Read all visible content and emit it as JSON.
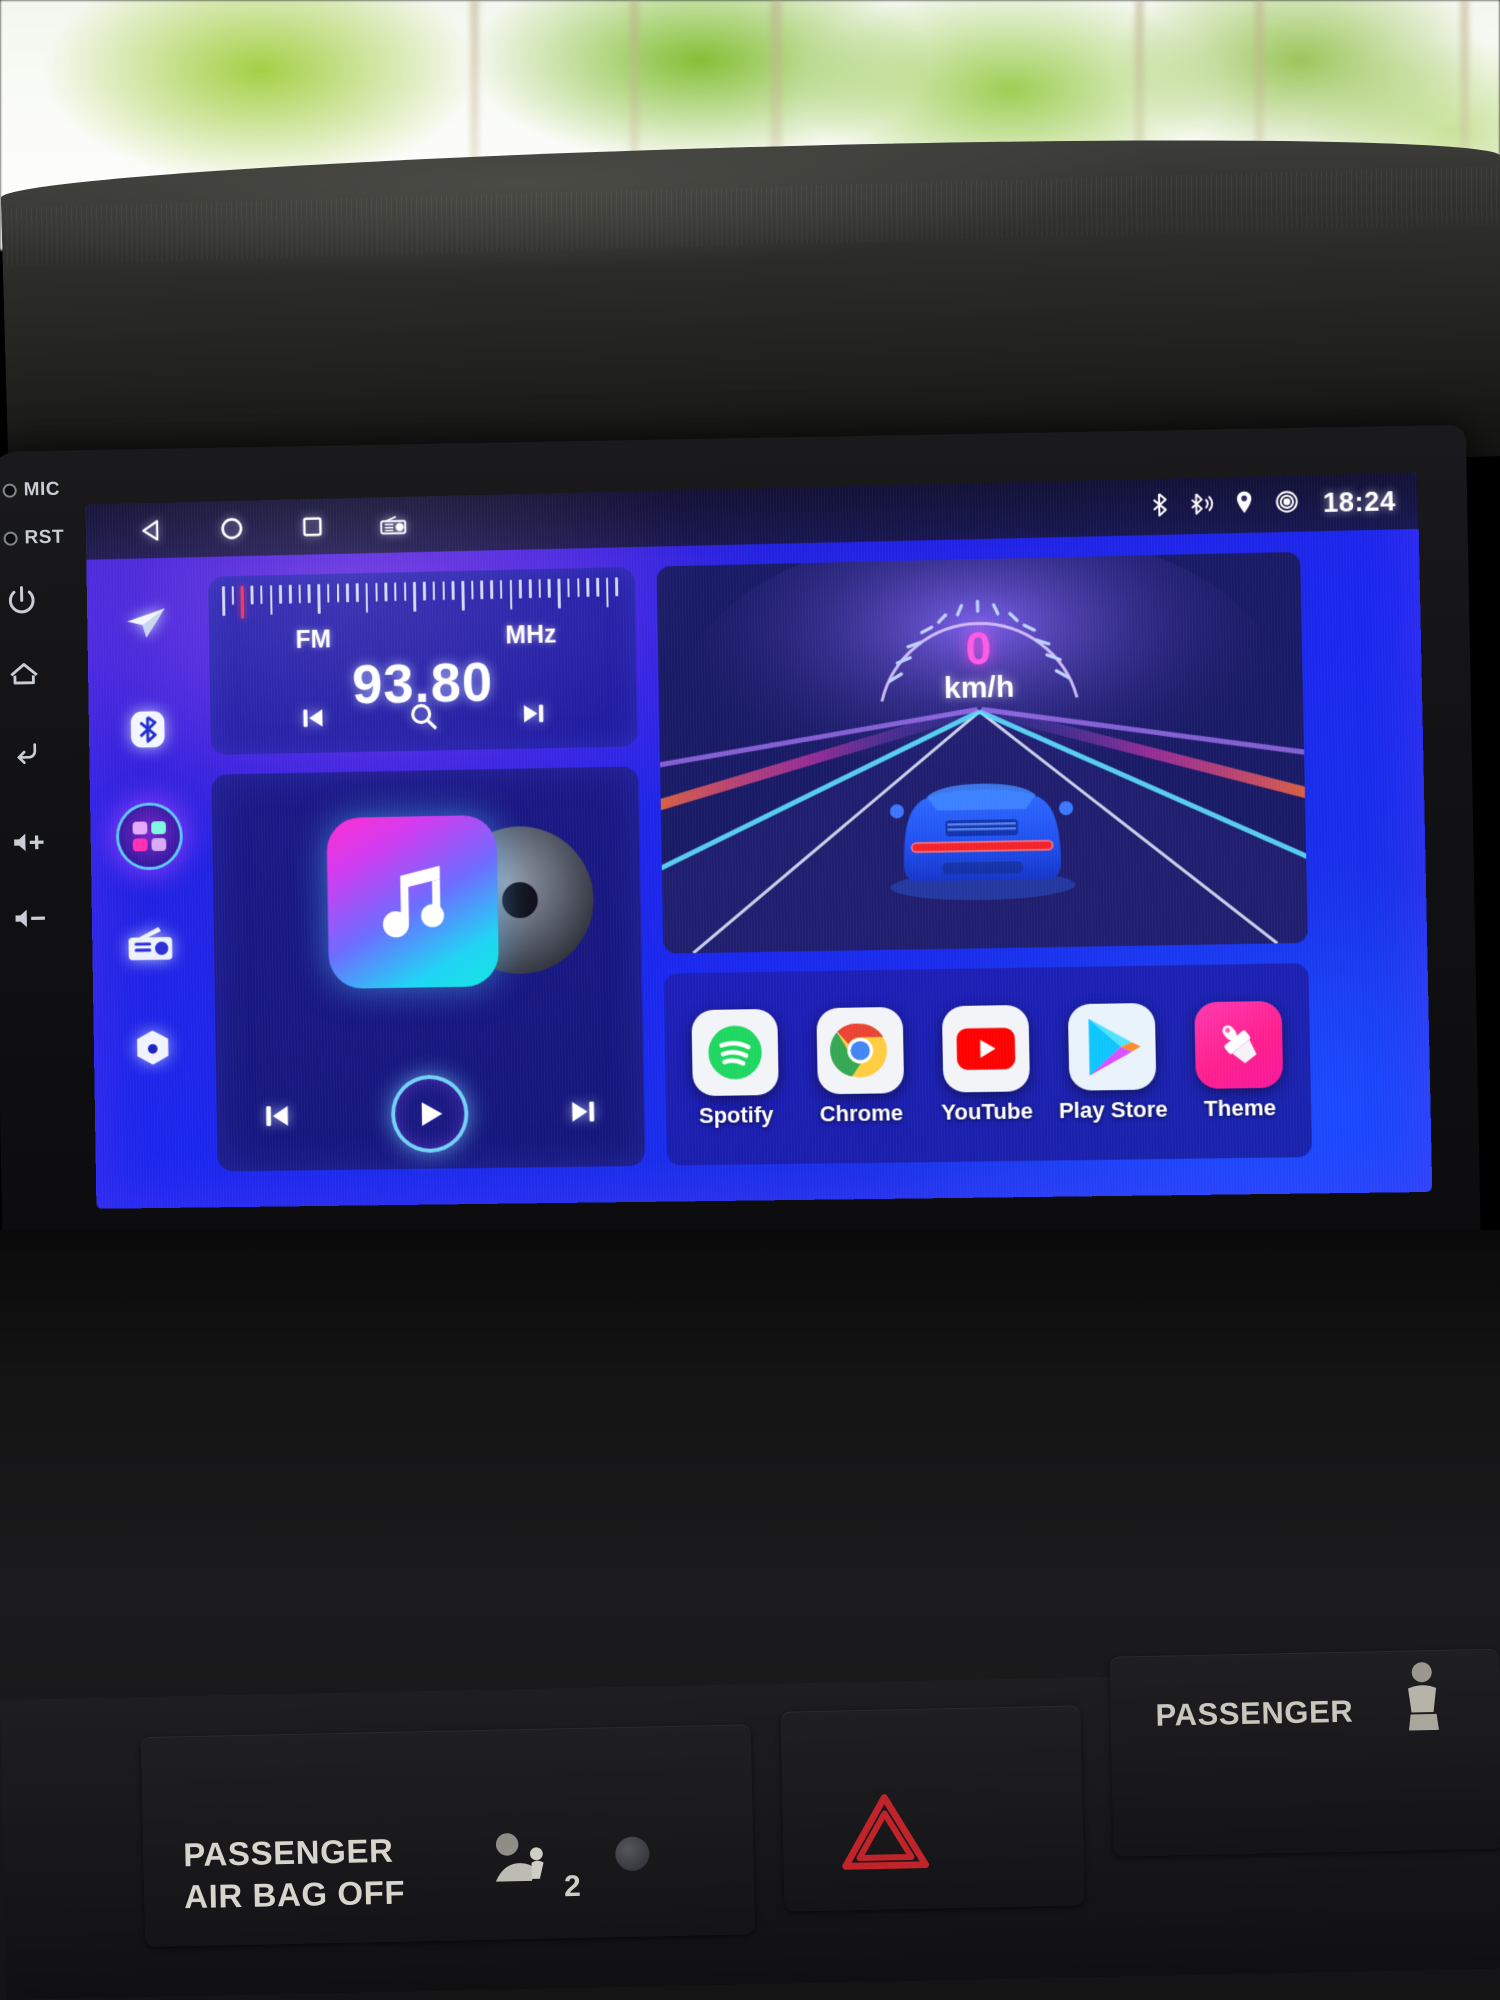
{
  "device": {
    "type": "android-car-head-unit",
    "bezel_buttons": [
      {
        "name": "mic",
        "label": "MIC",
        "icon": "mic-indicator"
      },
      {
        "name": "reset",
        "label": "RST",
        "icon": "reset-indicator"
      },
      {
        "name": "power",
        "label": "",
        "icon": "power-icon"
      },
      {
        "name": "home",
        "label": "",
        "icon": "home-icon"
      },
      {
        "name": "back",
        "label": "",
        "icon": "back-arrow-icon"
      },
      {
        "name": "volume-up",
        "label": "",
        "icon": "volume-up-icon"
      },
      {
        "name": "volume-down",
        "label": "",
        "icon": "volume-down-icon"
      }
    ]
  },
  "statusbar": {
    "nav_buttons": [
      {
        "name": "back",
        "icon": "triangle-back-icon"
      },
      {
        "name": "home",
        "icon": "circle-home-icon"
      },
      {
        "name": "recents",
        "icon": "square-recents-icon"
      },
      {
        "name": "radio",
        "icon": "radio-icon"
      }
    ],
    "system_icons": [
      {
        "name": "bluetooth",
        "icon": "bluetooth-icon"
      },
      {
        "name": "bluetooth-audio",
        "icon": "bluetooth-audio-icon"
      },
      {
        "name": "location",
        "icon": "location-pin-icon"
      },
      {
        "name": "gps-signal",
        "icon": "gps-signal-icon"
      }
    ],
    "clock": "18:24"
  },
  "sidebar": {
    "items": [
      {
        "name": "navigation",
        "icon": "navigation-arrow-icon",
        "active": false
      },
      {
        "name": "bluetooth",
        "icon": "bluetooth-icon",
        "active": false
      },
      {
        "name": "apps",
        "icon": "apps-grid-icon",
        "active": true
      },
      {
        "name": "radio",
        "icon": "radio-icon",
        "active": false
      },
      {
        "name": "settings",
        "icon": "settings-gear-icon",
        "active": false
      }
    ]
  },
  "radio_widget": {
    "band": "FM",
    "unit": "MHz",
    "frequency": "93.80",
    "controls": [
      {
        "name": "previous-station",
        "icon": "skip-previous-icon"
      },
      {
        "name": "scan-station",
        "icon": "search-icon"
      },
      {
        "name": "next-station",
        "icon": "skip-next-icon"
      }
    ]
  },
  "music_widget": {
    "album_art_icon": "music-note-icon",
    "disc_icon": "cd-disc-icon",
    "controls": [
      {
        "name": "previous-track",
        "icon": "skip-previous-icon"
      },
      {
        "name": "play",
        "icon": "play-icon"
      },
      {
        "name": "next-track",
        "icon": "skip-next-icon"
      }
    ]
  },
  "speed_widget": {
    "value": "0",
    "unit": "km/h",
    "background_icon": "sports-car-neon-road"
  },
  "apps": [
    {
      "label": "Spotify",
      "icon": "spotify-icon",
      "color": "#1ed760"
    },
    {
      "label": "Chrome",
      "icon": "chrome-icon",
      "color": "#4285f4"
    },
    {
      "label": "YouTube",
      "icon": "youtube-icon",
      "color": "#ff0000"
    },
    {
      "label": "Play Store",
      "icon": "play-store-icon",
      "color": "#00a0ff"
    },
    {
      "label": "Theme",
      "icon": "theme-brush-icon",
      "color": "#ff2d9e"
    }
  ],
  "dashboard": {
    "passenger_airbag_line1": "PASSENGER",
    "passenger_airbag_line2": "AIR BAG OFF",
    "airbag_count": "2",
    "passenger_label": "PASSENGER",
    "hazard_icon": "hazard-triangle-icon",
    "airbag_icon": "airbag-person-icon",
    "passenger_icon": "seated-person-icon"
  },
  "colors": {
    "screen_blue": "#1f26e8",
    "accent_purple": "#7a2be0",
    "accent_cyan": "#5ae6ff",
    "speed_magenta": "#ff5ae6",
    "hazard_red": "#c0232a"
  }
}
